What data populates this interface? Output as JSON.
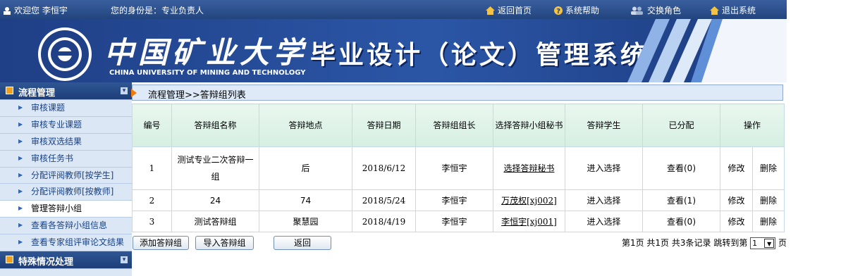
{
  "topbar": {
    "welcome": "欢迎您  李恒宇",
    "identity": "您的身份是：专业负责人",
    "links": {
      "home": "返回首页",
      "help": "系统帮助",
      "switch_role": "交换角色",
      "logout": "退出系统"
    }
  },
  "banner": {
    "university_cn": "中国矿业大学",
    "university_en": "CHINA UNIVERSITY OF MINING AND TECHNOLOGY",
    "system_title": "毕业设计（论文）管理系统"
  },
  "sidebar": {
    "section1": "流程管理",
    "items": [
      "审核课题",
      "审核专业课题",
      "审核双选结果",
      "审核任务书",
      "分配评阅教师[按学生]",
      "分配评阅教师[按教师]",
      "管理答辩小组",
      "查看各答辩小组信息",
      "查看专家组评审论文结果"
    ],
    "section2": "特殊情况处理"
  },
  "breadcrumb": "流程管理>>答辩组列表",
  "table": {
    "headers": [
      "编号",
      "答辩组名称",
      "答辩地点",
      "答辩日期",
      "答辩组组长",
      "选择答辩小组秘书",
      "答辩学生",
      "已分配",
      "操作"
    ],
    "rows": [
      {
        "no": "1",
        "name": "测试专业二次答辩一组",
        "place": "后",
        "date": "2018/6/12",
        "leader": "李恒宇",
        "secretary": "选择答辩秘书",
        "students": "进入选择",
        "assigned": "查看(0)",
        "edit": "修改",
        "delete": "删除"
      },
      {
        "no": "2",
        "name": "24",
        "place": "74",
        "date": "2018/5/24",
        "leader": "李恒宇",
        "secretary": "万茂权[xj002]",
        "students": "进入选择",
        "assigned": "查看(1)",
        "edit": "修改",
        "delete": "删除"
      },
      {
        "no": "3",
        "name": "测试答辩组",
        "place": "聚慧园",
        "date": "2018/4/19",
        "leader": "李恒宇",
        "secretary": "李恒宇[xj001]",
        "students": "进入选择",
        "assigned": "查看(0)",
        "edit": "修改",
        "delete": "删除"
      }
    ]
  },
  "buttons": {
    "add": "添加答辩组",
    "import": "导入答辩组",
    "back": "返回"
  },
  "pager": {
    "text": "第1页  共1页  共3条记录  跳转到第",
    "page": "1",
    "suffix": "页"
  }
}
